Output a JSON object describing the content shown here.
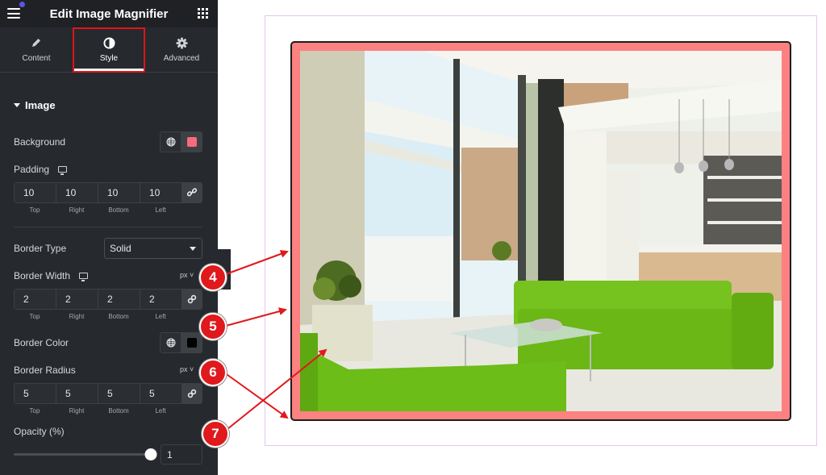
{
  "panel": {
    "title": "Edit Image Magnifier",
    "menu_icon": "hamburger-icon",
    "apps_icon": "grid-icon",
    "tabs": [
      {
        "label": "Content",
        "icon": "pencil-icon",
        "active": false
      },
      {
        "label": "Style",
        "icon": "contrast-icon",
        "active": true
      },
      {
        "label": "Advanced",
        "icon": "gear-icon",
        "active": false
      }
    ],
    "section_title": "Image",
    "background": {
      "label": "Background",
      "color": "#f76b7a"
    },
    "padding": {
      "label": "Padding",
      "values": [
        "10",
        "10",
        "10",
        "10"
      ],
      "sides": [
        "Top",
        "Right",
        "Bottom",
        "Left"
      ]
    },
    "border_type": {
      "label": "Border Type",
      "value": "Solid"
    },
    "border_width": {
      "label": "Border Width",
      "unit": "px",
      "values": [
        "2",
        "2",
        "2",
        "2"
      ],
      "sides": [
        "Top",
        "Right",
        "Bottom",
        "Left"
      ]
    },
    "border_color": {
      "label": "Border Color",
      "color": "#000000"
    },
    "border_radius": {
      "label": "Border Radius",
      "unit": "px",
      "values": [
        "5",
        "5",
        "5",
        "5"
      ],
      "sides": [
        "Top",
        "Right",
        "Bottom",
        "Left"
      ]
    },
    "opacity": {
      "label": "Opacity (%)",
      "value": "1",
      "fraction": 1.0
    }
  },
  "preview": {
    "frame_background": "#fc8181",
    "frame_border": "#1d1d1d",
    "image_description": "Modern living room with green sofas"
  },
  "callouts": [
    "4",
    "5",
    "6",
    "7"
  ],
  "colors": {
    "accent_red": "#e0191c",
    "panel_bg": "#26292e"
  }
}
